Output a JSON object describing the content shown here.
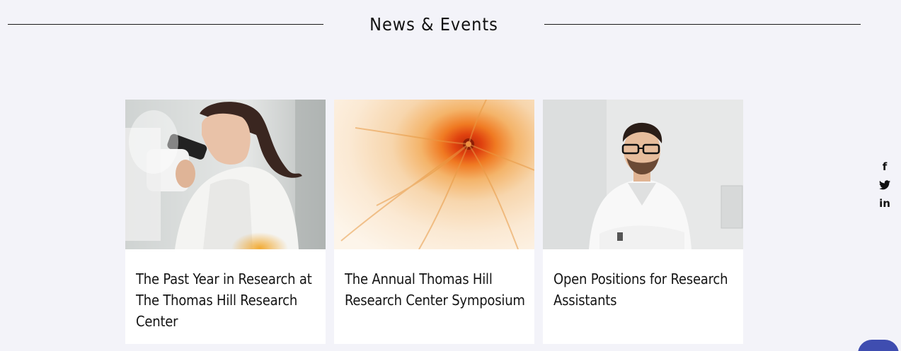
{
  "section": {
    "title": "News & Events"
  },
  "cards": [
    {
      "title": "The Past Year in Research at The Thomas Hill Research Center",
      "image": "scientist-microscope-photo"
    },
    {
      "title": "The Annual Thomas Hill Research Center Symposium",
      "image": "orange-culture-photo"
    },
    {
      "title": "Open Positions for Research Assistants",
      "image": "researcher-portrait-photo"
    }
  ],
  "social": {
    "facebook_glyph": "f",
    "twitter_icon": "twitter-icon",
    "linkedin_glyph": "in"
  },
  "colors": {
    "background": "#f3f3f9",
    "card": "#ffffff",
    "chat_button": "#3f4db0"
  }
}
